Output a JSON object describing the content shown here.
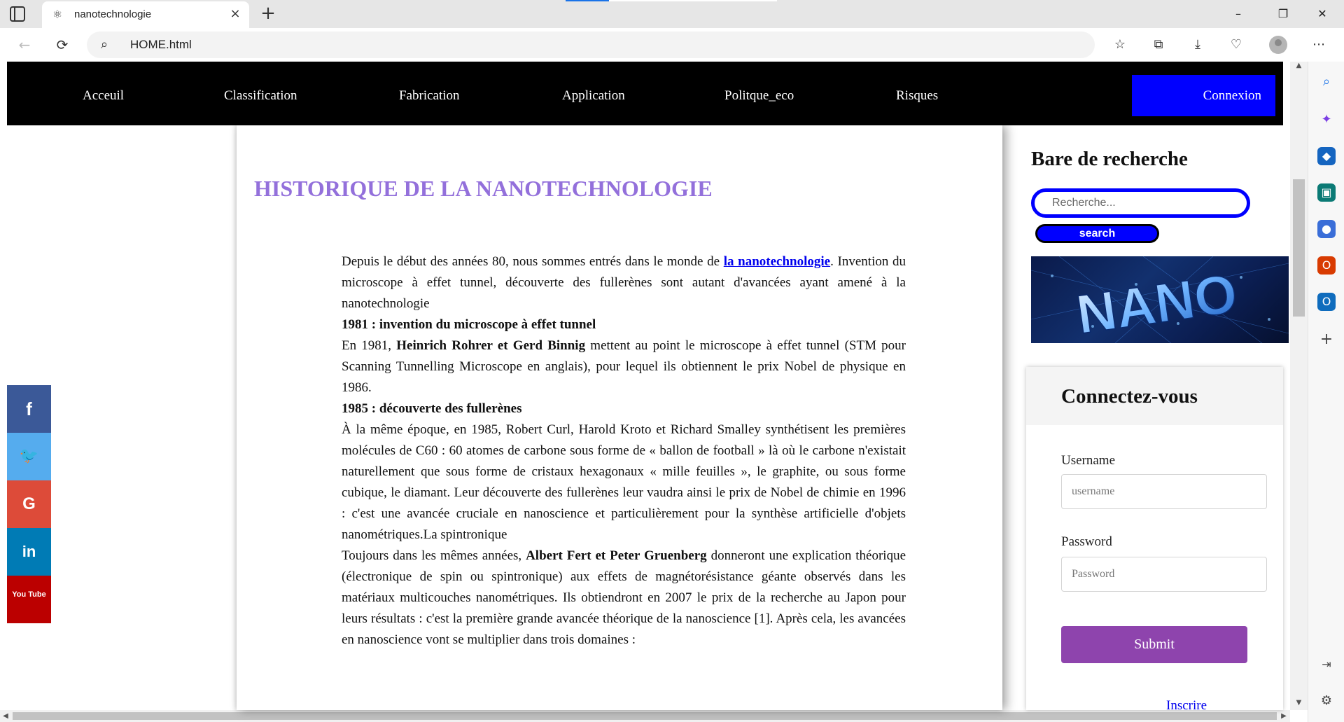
{
  "browser": {
    "tab_title": "nanotechnologie",
    "url": "HOME.html",
    "favicon": "molecule-icon",
    "icons": {
      "tab_actions": "tab-actions-icon",
      "close_tab": "×",
      "new_tab": "+",
      "minimize": "–",
      "maximize": "❐",
      "close_window": "✕",
      "back": "←",
      "reload": "⟳",
      "favorites": "☆",
      "collections": "⧉",
      "downloads": "⤓",
      "health": "♡",
      "more": "⋯"
    }
  },
  "nav": {
    "items": [
      "Acceuil",
      "Classification",
      "Fabrication",
      "Application",
      "Politque_eco",
      "Risques"
    ],
    "connexion": "Connexion"
  },
  "article": {
    "title": "HISTORIQUE DE LA NANOTECHNOLOGIE",
    "p1_before_link": "Depuis le début des années 80, nous sommes entrés dans le monde de ",
    "p1_link": "la nanotechnologie",
    "p1_after_link": ". Invention du microscope à effet tunnel, découverte des fullerènes sont autant d'avancées ayant amené à la nanotechnologie",
    "h1981": "1981 : invention du microscope à effet tunnel",
    "p2_before_bold": "En 1981, ",
    "p2_bold": "Heinrich Rohrer et Gerd Binnig",
    "p2_after_bold": " mettent au point le microscope à effet tunnel (STM pour Scanning Tunnelling Microscope en anglais), pour lequel ils obtiennent le prix Nobel de physique en 1986.",
    "h1985": "1985 : découverte des fullerènes",
    "p3": "À la même époque, en 1985, Robert Curl, Harold Kroto et Richard Smalley synthétisent les premières molécules de C60 : 60 atomes de carbone sous forme de « ballon de football » là où le carbone n'existait naturellement que sous forme de cristaux hexagonaux « mille feuilles », le graphite, ou sous forme cubique, le diamant. Leur découverte des fullerènes leur vaudra ainsi le prix de Nobel de chimie en 1996 : c'est une avancée cruciale en nanoscience et particulièrement pour la synthèse artificielle d'objets nanométriques.La spintronique",
    "p4_before_bold": "Toujours dans les mêmes années, ",
    "p4_bold": "Albert Fert et Peter Gruenberg",
    "p4_after_bold": " donneront une explication théorique (électronique de spin ou spintronique) aux effets de magnétorésistance géante observés dans les matériaux multicouches nanométriques. Ils obtiendront en 2007 le prix de la recherche au Japon pour leurs résultats : c'est la première grande avancée théorique de la nanoscience [1]. Après cela, les avancées en nanoscience vont se multiplier dans trois domaines :"
  },
  "social": [
    {
      "icon": "facebook-icon",
      "glyph": "f",
      "color": "#3b5998"
    },
    {
      "icon": "twitter-icon",
      "glyph": "🐦",
      "color": "#55acee"
    },
    {
      "icon": "google-icon",
      "glyph": "G",
      "color": "#dd4b39"
    },
    {
      "icon": "linkedin-icon",
      "glyph": "in",
      "color": "#007bb5"
    },
    {
      "icon": "youtube-icon",
      "glyph": "You Tube",
      "color": "#bb0000"
    }
  ],
  "sidebar": {
    "search_title": "Bare de recherche",
    "search_placeholder": "Recherche...",
    "search_button": "search",
    "image_text": "NANO"
  },
  "login": {
    "title": "Connectez-vous",
    "username_label": "Username",
    "username_placeholder": "username",
    "password_label": "Password",
    "password_placeholder": "Password",
    "submit": "Submit",
    "register_link": "Inscrire"
  },
  "colors": {
    "nav_bg": "#000000",
    "connexion_bg": "#0000ff",
    "title_color": "#9370db",
    "submit_bg": "#8e44ad",
    "link_color": "#0000ee"
  }
}
